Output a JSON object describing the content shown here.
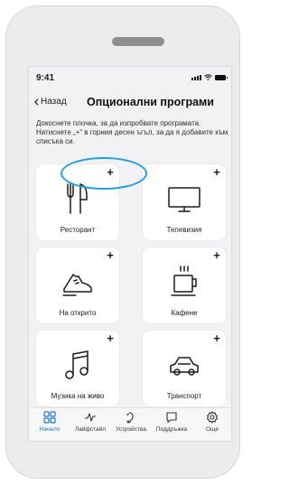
{
  "status": {
    "time": "9:41"
  },
  "nav": {
    "back_label": "Назад",
    "title": "Опционални програми"
  },
  "description": "Докоснете плочка, за да изпробвате програмата. Натиснете „+“ в горния десен ъгъл, за да я добавите към списъка си.",
  "tiles": [
    {
      "label": "Ресторант",
      "icon": "utensils-icon",
      "add": "+"
    },
    {
      "label": "Телевизия",
      "icon": "tv-icon",
      "add": "+"
    },
    {
      "label": "На открито",
      "icon": "shoe-icon",
      "add": "+"
    },
    {
      "label": "Кафене",
      "icon": "coffee-cup-icon",
      "add": "+"
    },
    {
      "label": "Музика на живо",
      "icon": "music-note-icon",
      "add": "+"
    },
    {
      "label": "Транспорт",
      "icon": "car-icon",
      "add": "+"
    },
    {
      "label": "",
      "icon": "",
      "add": "+"
    }
  ],
  "tabbar": [
    {
      "label": "Начало",
      "icon": "home-grid-icon",
      "active": true
    },
    {
      "label": "Лайфстайл",
      "icon": "activity-icon",
      "active": false
    },
    {
      "label": "Устройства",
      "icon": "hearing-aid-icon",
      "active": false
    },
    {
      "label": "Поддръжка",
      "icon": "chat-bubble-icon",
      "active": false
    },
    {
      "label": "Още",
      "icon": "gear-icon",
      "active": false
    }
  ],
  "colors": {
    "accent": "#1f74c9",
    "highlight": "#1f9fdc"
  }
}
